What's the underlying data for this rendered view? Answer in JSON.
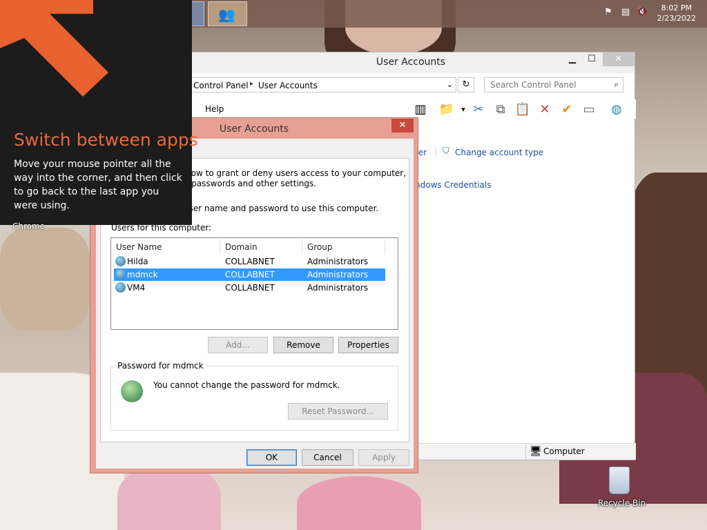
{
  "taskbar": {
    "clock_time": "8:02 PM",
    "clock_date": "2/23/2022",
    "tray_icons": [
      "action-center-flag-icon",
      "network-icon",
      "volume-muted-icon"
    ]
  },
  "switch_overlay": {
    "title": "Switch between apps",
    "body": "Move your mouse pointer all the way into the corner, and then click to go back to the last app you were using.",
    "accent_color": "#e86a3e"
  },
  "desktop": {
    "chrome_label": "Chrome",
    "recycle_bin_label": "Recycle Bin"
  },
  "control_panel": {
    "title": "User Accounts",
    "breadcrumb": [
      "Control Panel",
      "User Accounts"
    ],
    "search_placeholder": "Search Control Panel",
    "menu": {
      "help": "Help"
    },
    "links": {
      "partial_top": "ter",
      "change_account_type": "Change account type",
      "partial_credentials": "ndows Credentials"
    },
    "status_computer": "Computer"
  },
  "dialog": {
    "title": "User Accounts",
    "intro_line1": "elow to grant or deny users access to your computer,",
    "intro_line2": "e passwords and other settings.",
    "checkbox_text": "user name and password to use this computer.",
    "users_label": "Users for this computer:",
    "columns": [
      "User Name",
      "Domain",
      "Group"
    ],
    "rows": [
      {
        "name": "Hilda",
        "domain": "COLLABNET",
        "group": "Administrators"
      },
      {
        "name": "mdmck",
        "domain": "COLLABNET",
        "group": "Administrators"
      },
      {
        "name": "VM4",
        "domain": "COLLABNET",
        "group": "Administrators"
      }
    ],
    "selected_row": 1,
    "buttons": {
      "add": "Add...",
      "remove": "Remove",
      "properties": "Properties"
    },
    "password_group": {
      "legend": "Password for mdmck",
      "message": "You cannot change the password for mdmck.",
      "reset_button": "Reset Password..."
    },
    "footer": {
      "ok": "OK",
      "cancel": "Cancel",
      "apply": "Apply"
    },
    "accent_color": "#e7a093"
  }
}
